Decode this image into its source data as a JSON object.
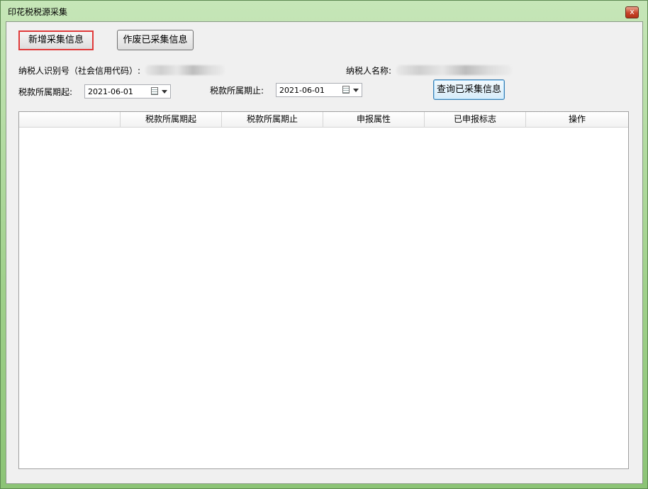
{
  "window": {
    "title": "印花税税源采集",
    "close_label": "x"
  },
  "toolbar": {
    "add_label": "新增采集信息",
    "void_label": "作废已采集信息",
    "query_label": "查询已采集信息"
  },
  "taxpayer": {
    "id_label": "纳税人识别号（社会信用代码）:",
    "name_label": "纳税人名称:"
  },
  "period": {
    "start_label": "税款所属期起:",
    "start_value": "2021-06-01",
    "end_label": "税款所属期止:",
    "end_value": "2021-06-01"
  },
  "grid": {
    "columns": [
      "",
      "税款所属期起",
      "税款所属期止",
      "申报属性",
      "已申报标志",
      "操作"
    ],
    "rows": []
  }
}
